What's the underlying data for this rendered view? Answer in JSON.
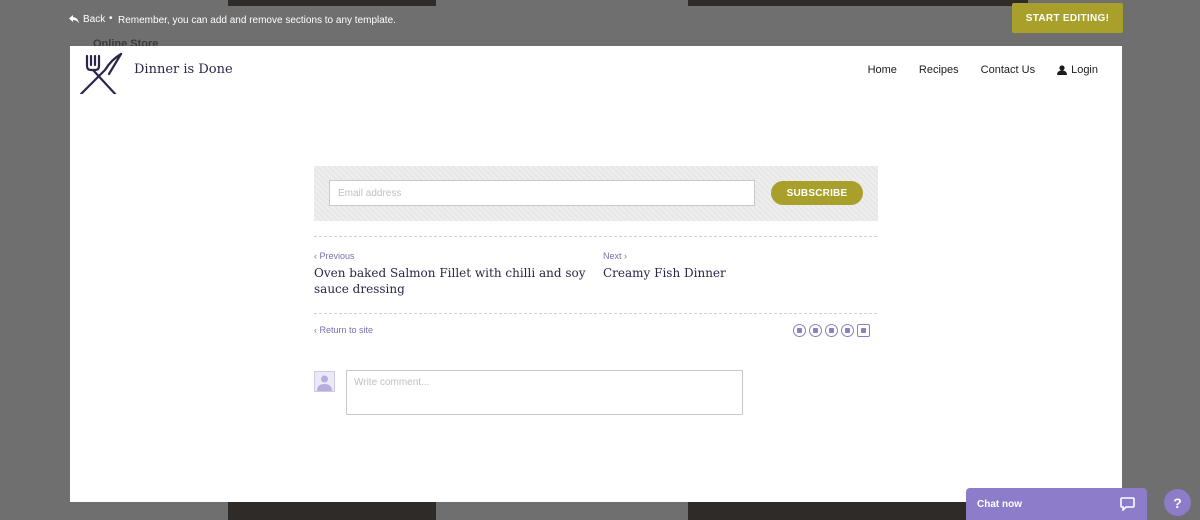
{
  "background": {
    "sidebar_item_1": "Online Store"
  },
  "topbar": {
    "back_label": "Back",
    "bullet": "•",
    "notice": "Remember, you can add and remove sections to any template.",
    "start_editing_label": "START EDITING!"
  },
  "site": {
    "brand": "Dinner is Done",
    "nav": [
      "Home",
      "Recipes",
      "Contact Us",
      "Login"
    ]
  },
  "subscribe": {
    "email_placeholder": "Email address",
    "button_label": "SUBSCRIBE"
  },
  "post_nav": {
    "previous_label": "‹ Previous",
    "previous_title": "Oven baked Salmon Fillet with chilli and soy sauce dressing",
    "next_label": "Next ›",
    "next_title": "Creamy Fish Dinner"
  },
  "return_label": "‹ Return to site",
  "social_icons": [
    "facebook-icon",
    "twitter-icon",
    "linkedin-icon",
    "pinterest-icon",
    "email-icon"
  ],
  "comment": {
    "placeholder": "Write comment..."
  },
  "chat": {
    "label": "Chat now",
    "help_label": "?"
  },
  "colors": {
    "accent": "#a8a02a",
    "chat_purple": "#8c7cc9",
    "brand_text": "#2c2548",
    "link": "#7a6fb0"
  }
}
